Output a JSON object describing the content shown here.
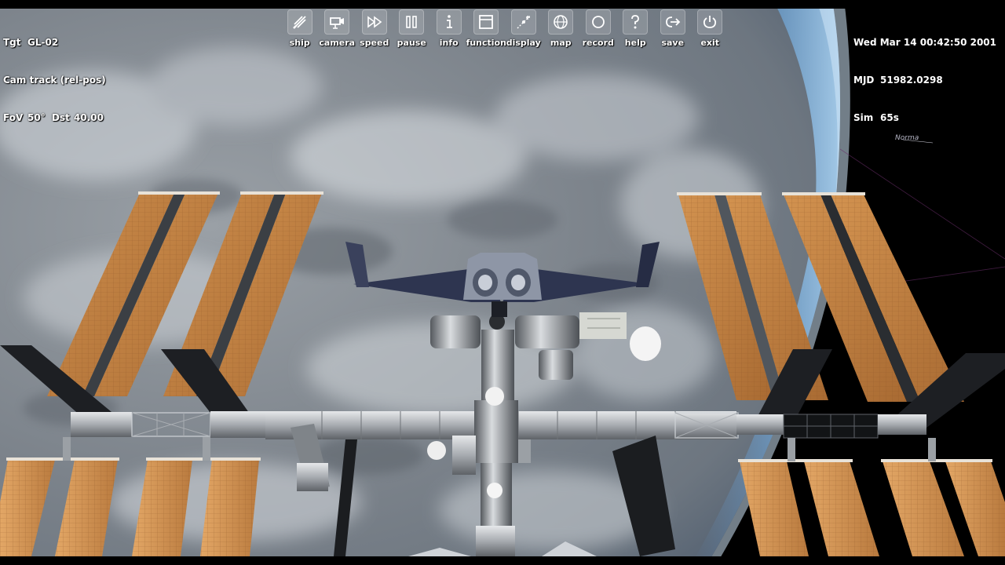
{
  "hud_left": {
    "tgt_label": "Tgt",
    "tgt_value": "GL-02",
    "cam_text": "Cam track (rel-pos)",
    "fov_label": "FoV",
    "fov_value": "50°",
    "dst_label": "Dst",
    "dst_value": "40.00"
  },
  "hud_right": {
    "datetime": "Wed Mar 14 00:42:50 2001",
    "mjd_label": "MJD",
    "mjd_value": "51982.0298",
    "sim_label": "Sim",
    "sim_value": "65s"
  },
  "toolbar": [
    {
      "label": "ship",
      "icon": "ship-icon"
    },
    {
      "label": "camera",
      "icon": "camera-icon"
    },
    {
      "label": "speed",
      "icon": "speed-icon"
    },
    {
      "label": "pause",
      "icon": "pause-icon"
    },
    {
      "label": "info",
      "icon": "info-icon"
    },
    {
      "label": "function",
      "icon": "function-icon"
    },
    {
      "label": "display",
      "icon": "display-icon"
    },
    {
      "label": "map",
      "icon": "map-icon"
    },
    {
      "label": "record",
      "icon": "record-icon"
    },
    {
      "label": "help",
      "icon": "help-icon"
    },
    {
      "label": "save",
      "icon": "save-icon"
    },
    {
      "label": "exit",
      "icon": "exit-icon"
    }
  ],
  "scene": {
    "star_label": "Norma",
    "colors": {
      "space": "#000000",
      "earth_cloud": "#8a9098",
      "atmosphere": "#6fa6d8",
      "solar_panel": "#c88a4a",
      "truss": "#b8bcc0"
    }
  }
}
